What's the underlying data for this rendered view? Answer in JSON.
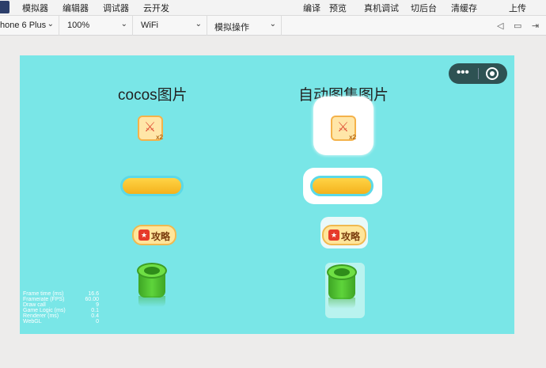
{
  "menubar": {
    "items": [
      "模拟器",
      "编辑器",
      "调试器",
      "云开发",
      "编译",
      "预览",
      "真机调试",
      "切后台",
      "清缓存",
      "上传"
    ]
  },
  "toolbar": {
    "device": "hone 6 Plus",
    "zoom": "100%",
    "network": "WiFi",
    "operation": "模拟操作"
  },
  "simulator": {
    "background": "#79e6e7",
    "left_title": "cocos图片",
    "right_title": "自动图集图片",
    "strategy_label": "攻略",
    "icon_badge": "x2",
    "stats": [
      {
        "label": "Frame time (ms)",
        "value": "16.6"
      },
      {
        "label": "Framerate (FPS)",
        "value": "60.00"
      },
      {
        "label": "Draw call",
        "value": "9"
      },
      {
        "label": "Game Logic (ms)",
        "value": "0.1"
      },
      {
        "label": "Renderer (ms)",
        "value": "0.4"
      },
      {
        "label": "WebGL",
        "value": "0"
      }
    ]
  }
}
